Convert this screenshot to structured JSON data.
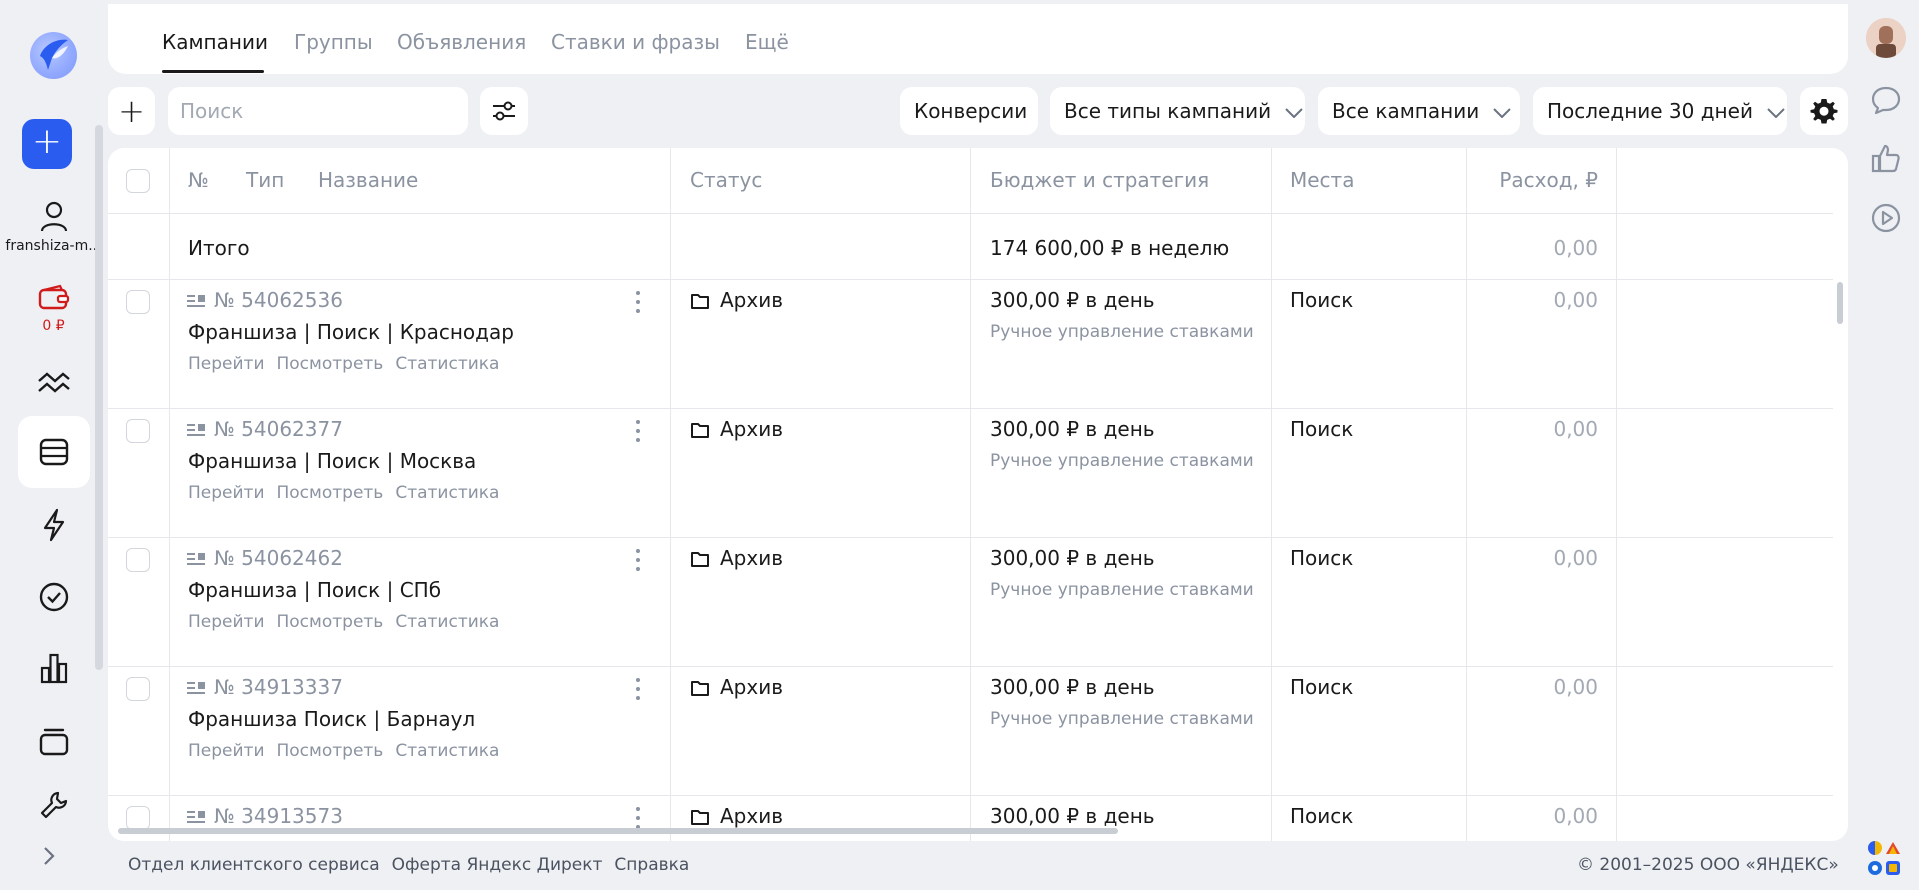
{
  "sidebar": {
    "user_label": "franshiza-m...",
    "wallet_label": "0 ₽",
    "accent_color": "#2b5cf0"
  },
  "tabs": [
    {
      "label": "Кампании",
      "active": true
    },
    {
      "label": "Группы",
      "active": false
    },
    {
      "label": "Объявления",
      "active": false
    },
    {
      "label": "Ставки и фразы",
      "active": false
    },
    {
      "label": "Ещё",
      "active": false
    }
  ],
  "toolbar": {
    "search_placeholder": "Поиск",
    "conversions_label": "Конверсии",
    "campaign_types_label": "Все типы кампаний",
    "campaigns_label": "Все кампании",
    "period_label": "Последние 30 дней"
  },
  "table": {
    "headers": {
      "num": "№",
      "type": "Тип",
      "name": "Название",
      "status": "Статус",
      "budget": "Бюджет и стратегия",
      "places": "Места",
      "spend": "Расход, ₽"
    },
    "total": {
      "label": "Итого",
      "budget": "174 600,00 ₽ в неделю",
      "spend": "0,00"
    },
    "row_links": {
      "go": "Перейти",
      "view": "Посмотреть",
      "stats": "Статистика"
    },
    "rows": [
      {
        "id": "№ 54062536",
        "name": "Франшиза | Поиск | Краснодар",
        "status": "Архив",
        "budget": "300,00 ₽ в день",
        "strategy": "Ручное управление ставками",
        "places": "Поиск",
        "spend": "0,00"
      },
      {
        "id": "№ 54062377",
        "name": "Франшиза | Поиск | Москва",
        "status": "Архив",
        "budget": "300,00 ₽ в день",
        "strategy": "Ручное управление ставками",
        "places": "Поиск",
        "spend": "0,00"
      },
      {
        "id": "№ 54062462",
        "name": "Франшиза | Поиск | СПб",
        "status": "Архив",
        "budget": "300,00 ₽ в день",
        "strategy": "Ручное управление ставками",
        "places": "Поиск",
        "spend": "0,00"
      },
      {
        "id": "№ 34913337",
        "name": "Франшиза Поиск | Барнаул",
        "status": "Архив",
        "budget": "300,00 ₽ в день",
        "strategy": "Ручное управление ставками",
        "places": "Поиск",
        "spend": "0,00"
      },
      {
        "id": "№ 34913573",
        "name": "",
        "status": "Архив",
        "budget": "300,00 ₽ в день",
        "strategy": "",
        "places": "Поиск",
        "spend": "0,00"
      }
    ]
  },
  "footer": {
    "client_service": "Отдел клиентского сервиса",
    "offer": "Оферта Яндекс Директ",
    "help": "Справка",
    "copyright": "© 2001–2025 ООО «ЯНДЕКС»"
  }
}
